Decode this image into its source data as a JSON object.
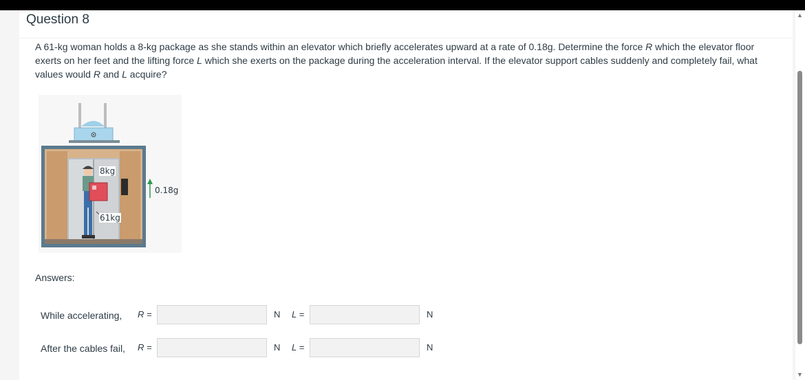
{
  "question": {
    "title": "Question 8",
    "text_part1": "A 61-kg woman holds a 8-kg package as she stands within an elevator which briefly accelerates upward at a rate of 0.18g. Determine the force ",
    "var_R": "R",
    "text_part2": " which the elevator floor exerts on her feet and the lifting force ",
    "var_L": "L",
    "text_part3": " which she exerts on the package during the acceleration interval. If the elevator support cables suddenly and completely fail, what values would ",
    "text_part4": " and ",
    "text_part5": " acquire?"
  },
  "figure": {
    "package_label": "8kg",
    "woman_label": "61kg",
    "accel_label": "0.18g"
  },
  "answers": {
    "label": "Answers:",
    "rows": [
      {
        "label": "While accelerating,",
        "R_label": "R =",
        "R_value": "",
        "R_unit": "N",
        "L_label": "L =",
        "L_value": "",
        "L_unit": "N"
      },
      {
        "label": "After the cables fail,",
        "R_label": "R =",
        "R_value": "",
        "R_unit": "N",
        "L_label": "L =",
        "L_value": "",
        "L_unit": "N"
      }
    ]
  },
  "icons": {
    "scroll_up": "triangle-up-icon",
    "scroll_down": "triangle-down-icon"
  }
}
